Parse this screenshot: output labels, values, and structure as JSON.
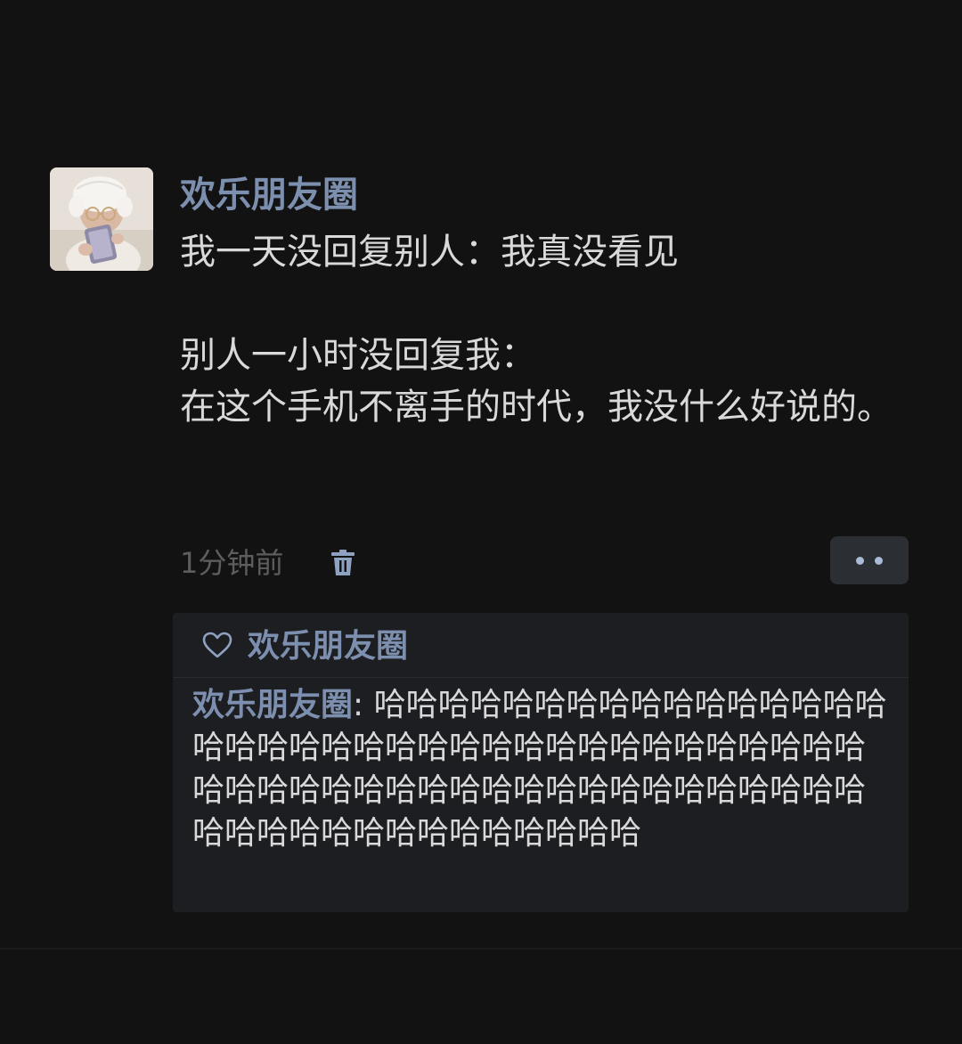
{
  "post": {
    "author": "欢乐朋友圈",
    "content": {
      "line1": "我一天没回复别人：我真没看见",
      "line2": "别人一小时没回复我：",
      "line3": "在这个手机不离手的时代，我没什么好说的。"
    },
    "time": "1分钟前",
    "icons": {
      "delete": "trash-icon",
      "more": "more-dots-icon",
      "like": "heart-icon"
    }
  },
  "interactions": {
    "likes": [
      "欢乐朋友圈"
    ],
    "comments": [
      {
        "author": "欢乐朋友圈",
        "separator": ":",
        "text": "哈哈哈哈哈哈哈哈哈哈哈哈哈哈哈哈哈哈哈哈哈哈哈哈哈哈哈哈哈哈哈哈哈哈哈哈哈哈哈哈哈哈哈哈哈哈哈哈哈哈哈哈哈哈哈哈哈哈哈哈哈哈哈哈哈哈哈哈哈哈哈哈"
      }
    ]
  },
  "colors": {
    "background": "#121212",
    "name_blue": "#7d8fae",
    "text": "#d9d9d9",
    "muted": "#5d5d5d",
    "panel": "#1d1e21"
  }
}
